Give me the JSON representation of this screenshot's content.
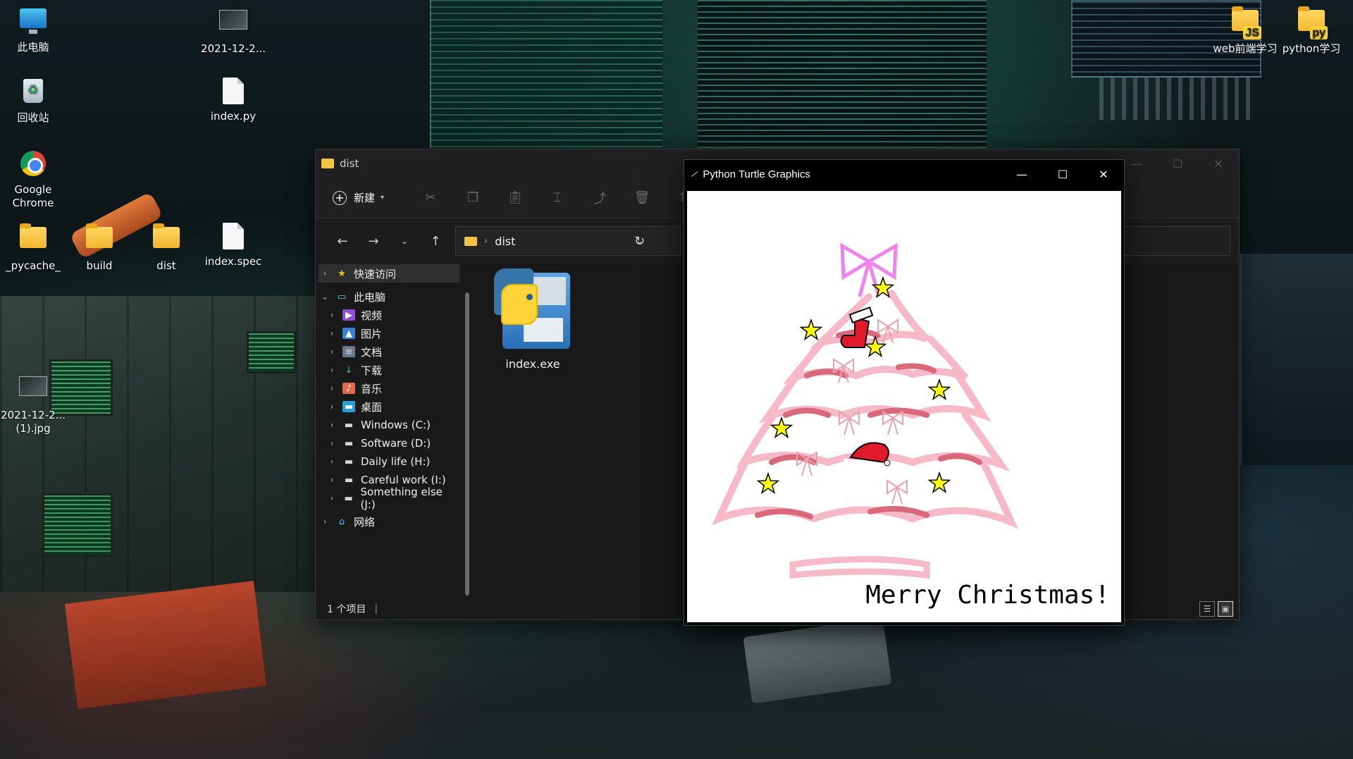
{
  "desktop": {
    "icons": [
      {
        "id": "this-pc",
        "label": "此电脑"
      },
      {
        "id": "recycle-bin",
        "label": "回收站"
      },
      {
        "id": "chrome",
        "label": "Google Chrome"
      },
      {
        "id": "pycache",
        "label": "_pycache_"
      },
      {
        "id": "build",
        "label": "build"
      },
      {
        "id": "dist",
        "label": "dist"
      },
      {
        "id": "index-spec",
        "label": "index.spec"
      },
      {
        "id": "index-py",
        "label": "index.py"
      },
      {
        "id": "screenshot-top",
        "label": "2021-12-2..."
      },
      {
        "id": "screenshot-jpg",
        "label": "2021-12-2... (1).jpg"
      },
      {
        "id": "web-folder",
        "label": "web前端学习",
        "badge": "JS"
      },
      {
        "id": "python-folder",
        "label": "python学习",
        "badge": "py"
      }
    ]
  },
  "explorer": {
    "title": "dist",
    "new_label": "新建",
    "address": {
      "folder": "dist"
    },
    "tree": [
      {
        "label": "快速访问",
        "icon": "star-icon",
        "level": 0,
        "expanded": false,
        "selected": true
      },
      {
        "label": "此电脑",
        "icon": "computer-icon",
        "level": 0,
        "expanded": true
      },
      {
        "label": "视频",
        "icon": "video-icon",
        "level": 1
      },
      {
        "label": "图片",
        "icon": "picture-icon",
        "level": 1
      },
      {
        "label": "文档",
        "icon": "document-icon",
        "level": 1
      },
      {
        "label": "下载",
        "icon": "download-icon",
        "level": 1
      },
      {
        "label": "音乐",
        "icon": "music-icon",
        "level": 1
      },
      {
        "label": "桌面",
        "icon": "desktop-icon",
        "level": 1
      },
      {
        "label": "Windows (C:)",
        "icon": "drive-icon",
        "level": 1
      },
      {
        "label": "Software (D:)",
        "icon": "drive-icon",
        "level": 1
      },
      {
        "label": "Daily life (H:)",
        "icon": "drive-icon",
        "level": 1
      },
      {
        "label": "Careful work (I:)",
        "icon": "drive-icon",
        "level": 1
      },
      {
        "label": "Something else (J:)",
        "icon": "drive-icon",
        "level": 1
      },
      {
        "label": "网络",
        "icon": "network-icon",
        "level": 0,
        "expanded": false
      }
    ],
    "files": [
      {
        "name": "index.exe",
        "icon": "python-exe-icon"
      }
    ],
    "status": "1 个项目"
  },
  "turtle": {
    "title": "Python Turtle Graphics",
    "message": "Merry Christmas!",
    "colors": {
      "tree_light": "#f7b8c8",
      "tree_dark": "#d9687a",
      "bow": "#ee82ee",
      "star_fill": "#ffff00",
      "sock": "#e0192b",
      "hat": "#e0192b"
    }
  }
}
